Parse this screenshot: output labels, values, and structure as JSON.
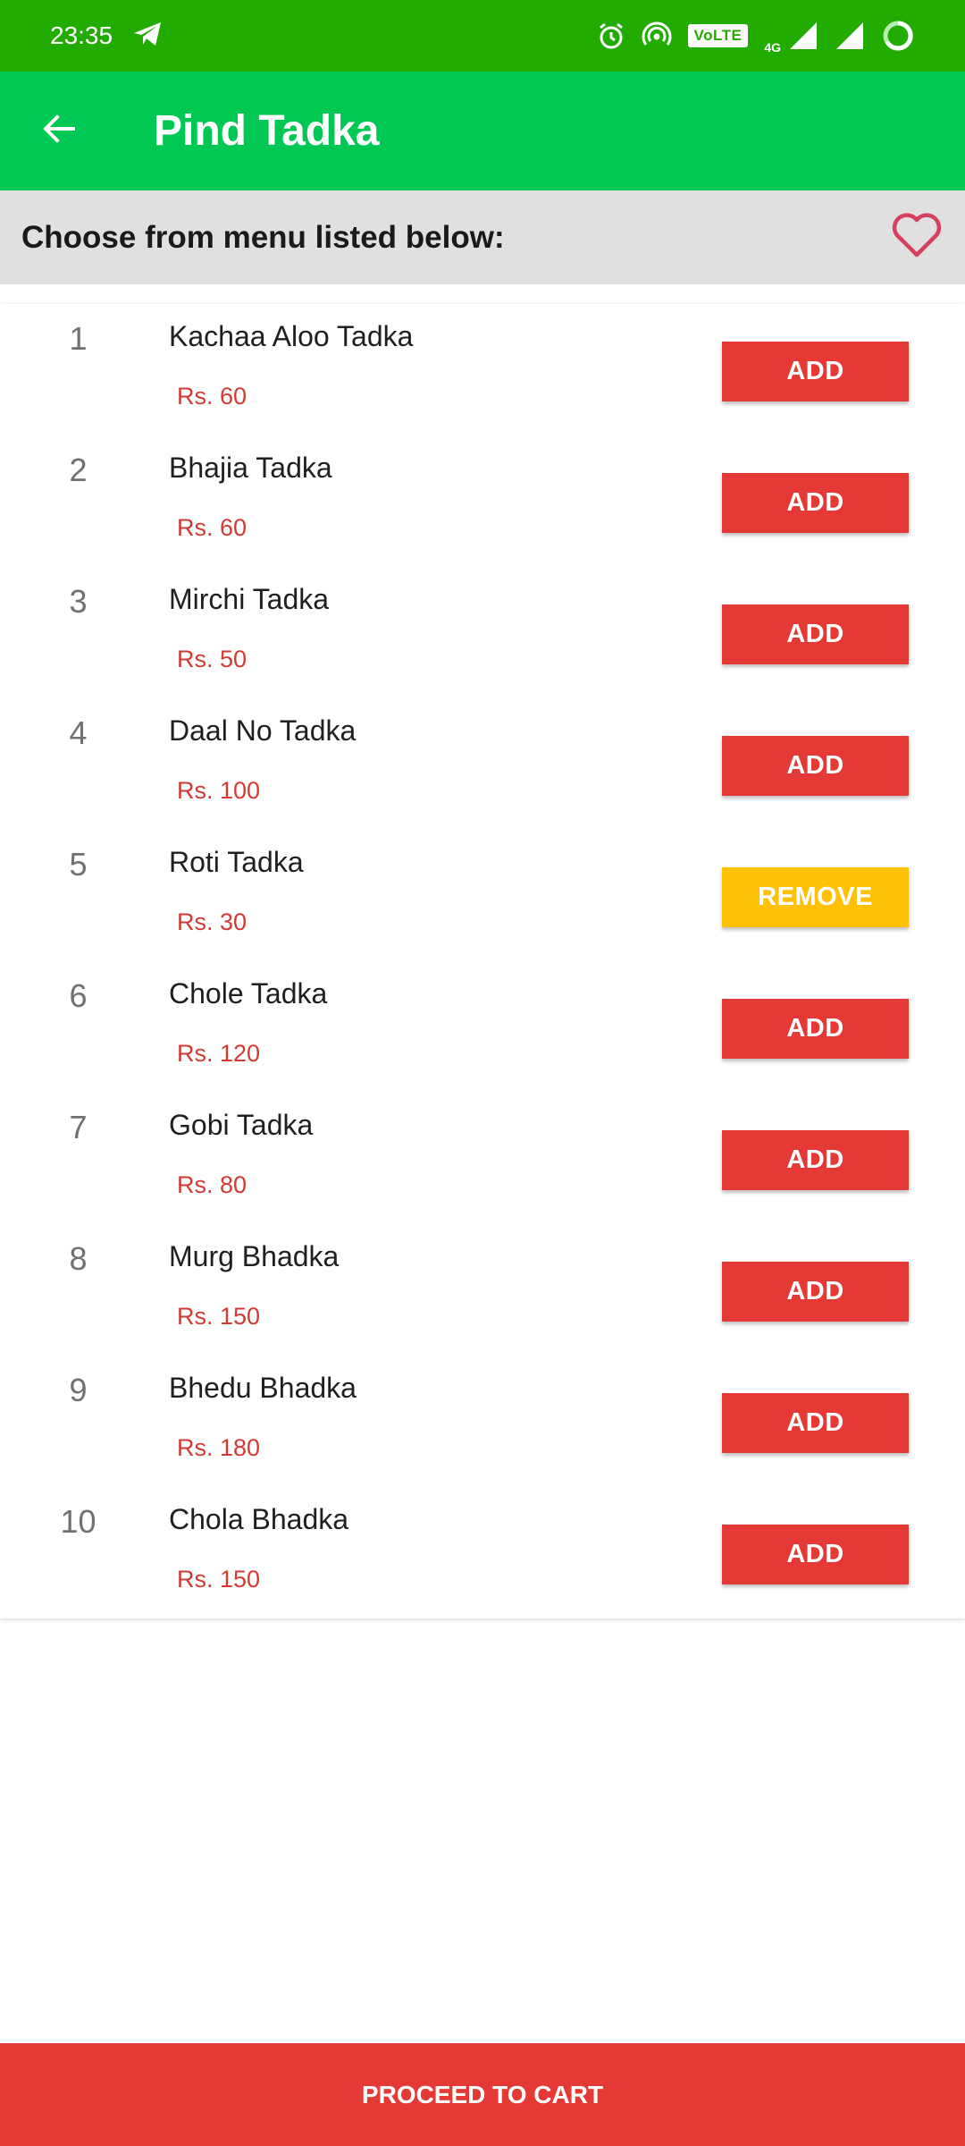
{
  "status_bar": {
    "time": "23:35",
    "volte": "VoLTE",
    "network": "4G",
    "icons": [
      "telegram-icon",
      "alarm-icon",
      "hotspot-icon",
      "volte-icon",
      "signal-icon",
      "signal-icon",
      "battery-icon"
    ]
  },
  "app_bar": {
    "title": "Pind Tadka",
    "back_icon": "arrow-left-icon"
  },
  "sub_header": {
    "text": "Choose from menu listed below:",
    "favorite_icon": "heart-outline-icon"
  },
  "menu": {
    "items": [
      {
        "number": "1",
        "name": "Kachaa Aloo Tadka",
        "price": "Rs. 60",
        "action": "ADD"
      },
      {
        "number": "2",
        "name": "Bhajia Tadka",
        "price": "Rs. 60",
        "action": "ADD"
      },
      {
        "number": "3",
        "name": "Mirchi Tadka",
        "price": "Rs. 50",
        "action": "ADD"
      },
      {
        "number": "4",
        "name": "Daal No Tadka",
        "price": "Rs. 100",
        "action": "ADD"
      },
      {
        "number": "5",
        "name": "Roti Tadka",
        "price": "Rs. 30",
        "action": "REMOVE"
      },
      {
        "number": "6",
        "name": "Chole Tadka",
        "price": "Rs. 120",
        "action": "ADD"
      },
      {
        "number": "7",
        "name": "Gobi Tadka",
        "price": "Rs. 80",
        "action": "ADD"
      },
      {
        "number": "8",
        "name": "Murg Bhadka",
        "price": "Rs. 150",
        "action": "ADD"
      },
      {
        "number": "9",
        "name": "Bhedu Bhadka",
        "price": "Rs. 180",
        "action": "ADD"
      },
      {
        "number": "10",
        "name": "Chola Bhadka",
        "price": "Rs. 150",
        "action": "ADD"
      }
    ]
  },
  "footer": {
    "proceed_label": "PROCEED TO CART"
  },
  "colors": {
    "status_bar": "#22ab00",
    "app_bar": "#00c853",
    "add_button": "#e53935",
    "remove_button": "#ffc107",
    "price_text": "#d33a34",
    "heart": "#d6405f"
  }
}
